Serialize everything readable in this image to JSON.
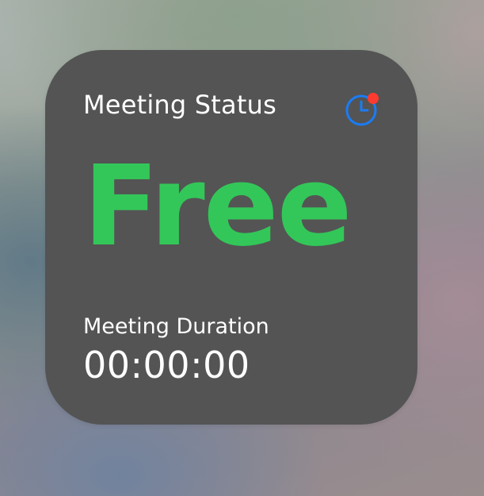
{
  "widget": {
    "title": "Meeting Status",
    "status": "Free",
    "duration_label": "Meeting Duration",
    "duration_value": "00:00:00",
    "icon": "clock-icon",
    "icon_badge": "notification-dot",
    "colors": {
      "status": "#33c759",
      "icon": "#1a7cf5",
      "badge": "#ff3b30",
      "background": "#545454",
      "text": "#ffffff"
    }
  }
}
